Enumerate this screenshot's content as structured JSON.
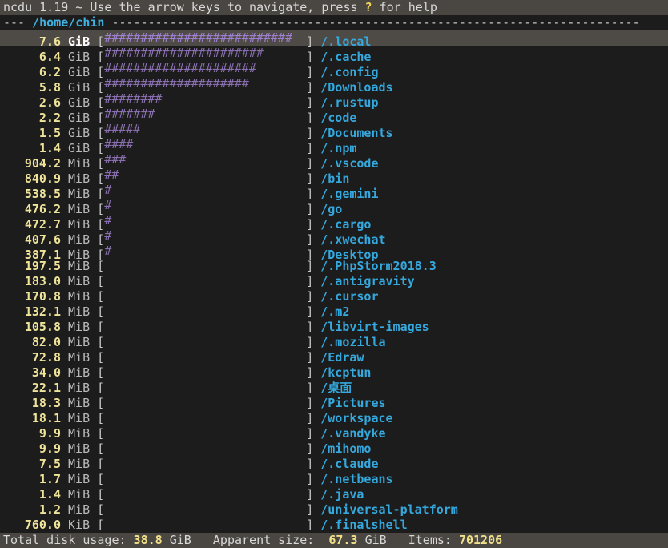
{
  "header": {
    "before_key": "ncdu 1.19 ~ Use the arrow keys to navigate, press ",
    "key": "?",
    "after_key": " for help"
  },
  "path": {
    "prefix": "--- ",
    "dir": "/home/chin",
    "suffix": " -------------------------------------------------------------------------"
  },
  "entries": [
    {
      "size": "7.6",
      "unit": "GiB",
      "bar": "##########################",
      "name": "/.local"
    },
    {
      "size": "6.4",
      "unit": "GiB",
      "bar": "######################",
      "name": "/.cache"
    },
    {
      "size": "6.2",
      "unit": "GiB",
      "bar": "#####################",
      "name": "/.config"
    },
    {
      "size": "5.8",
      "unit": "GiB",
      "bar": "####################",
      "name": "/Downloads"
    },
    {
      "size": "2.6",
      "unit": "GiB",
      "bar": "########",
      "name": "/.rustup"
    },
    {
      "size": "2.2",
      "unit": "GiB",
      "bar": "#######",
      "name": "/code"
    },
    {
      "size": "1.5",
      "unit": "GiB",
      "bar": "#####",
      "name": "/Documents"
    },
    {
      "size": "1.4",
      "unit": "GiB",
      "bar": "####",
      "name": "/.npm"
    },
    {
      "size": "904.2",
      "unit": "MiB",
      "bar": "###",
      "name": "/.vscode"
    },
    {
      "size": "840.9",
      "unit": "MiB",
      "bar": "##",
      "name": "/bin"
    },
    {
      "size": "538.5",
      "unit": "MiB",
      "bar": "#",
      "name": "/.gemini"
    },
    {
      "size": "476.2",
      "unit": "MiB",
      "bar": "#",
      "name": "/go"
    },
    {
      "size": "472.7",
      "unit": "MiB",
      "bar": "#",
      "name": "/.cargo"
    },
    {
      "size": "407.6",
      "unit": "MiB",
      "bar": "#",
      "name": "/.xwechat"
    },
    {
      "size": "387.1",
      "unit": "MiB",
      "bar": "#",
      "name": "/Desktop"
    },
    {
      "size": "197.5",
      "unit": "MiB",
      "bar": "",
      "name": "/.PhpStorm2018.3"
    },
    {
      "size": "183.0",
      "unit": "MiB",
      "bar": "",
      "name": "/.antigravity"
    },
    {
      "size": "170.8",
      "unit": "MiB",
      "bar": "",
      "name": "/.cursor"
    },
    {
      "size": "132.1",
      "unit": "MiB",
      "bar": "",
      "name": "/.m2"
    },
    {
      "size": "105.8",
      "unit": "MiB",
      "bar": "",
      "name": "/libvirt-images"
    },
    {
      "size": "82.0",
      "unit": "MiB",
      "bar": "",
      "name": "/.mozilla"
    },
    {
      "size": "72.8",
      "unit": "MiB",
      "bar": "",
      "name": "/Edraw"
    },
    {
      "size": "34.0",
      "unit": "MiB",
      "bar": "",
      "name": "/kcptun"
    },
    {
      "size": "22.1",
      "unit": "MiB",
      "bar": "",
      "name": "/桌面"
    },
    {
      "size": "18.3",
      "unit": "MiB",
      "bar": "",
      "name": "/Pictures"
    },
    {
      "size": "18.1",
      "unit": "MiB",
      "bar": "",
      "name": "/workspace"
    },
    {
      "size": "9.9",
      "unit": "MiB",
      "bar": "",
      "name": "/.vandyke"
    },
    {
      "size": "9.9",
      "unit": "MiB",
      "bar": "",
      "name": "/mihomo"
    },
    {
      "size": "7.5",
      "unit": "MiB",
      "bar": "",
      "name": "/.claude"
    },
    {
      "size": "1.7",
      "unit": "MiB",
      "bar": "",
      "name": "/.netbeans"
    },
    {
      "size": "1.4",
      "unit": "MiB",
      "bar": "",
      "name": "/.java"
    },
    {
      "size": "1.2",
      "unit": "MiB",
      "bar": "",
      "name": "/universal-platform"
    },
    {
      "size": "760.0",
      "unit": "KiB",
      "bar": "",
      "name": "/.finalshell"
    }
  ],
  "footer": {
    "total_label": "Total disk usage:",
    "total_value": "38.8",
    "total_unit": "GiB",
    "apparent_label": "Apparent size:",
    "apparent_value": "67.3",
    "apparent_unit": "GiB",
    "items_label": "Items:",
    "items_value": "701206"
  },
  "colors": {
    "background": "#1c1c1c",
    "status_bar": "#4a4641",
    "selected_row": "#4e4a45",
    "size_text": "#efe39a",
    "graph_hash": "#8a6fb0",
    "dir_name": "#35a8dd"
  }
}
